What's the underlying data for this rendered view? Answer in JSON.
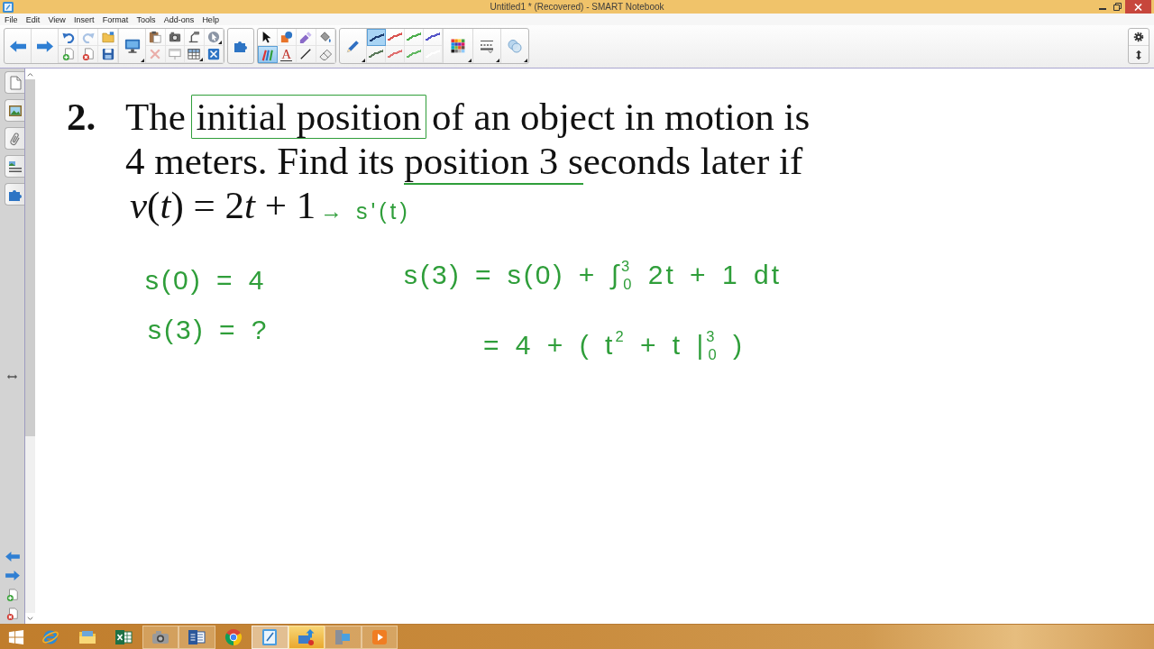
{
  "window": {
    "title": "Untitled1 * (Recovered) - SMART Notebook"
  },
  "menu": [
    "File",
    "Edit",
    "View",
    "Insert",
    "Format",
    "Tools",
    "Add-ons",
    "Help"
  ],
  "toolbar": {
    "edit_buttons": [
      {
        "kind": "undo",
        "disabled": false
      },
      {
        "kind": "redo",
        "disabled": true
      },
      {
        "kind": "open",
        "disabled": false
      },
      {
        "kind": "add_page",
        "disabled": false
      },
      {
        "kind": "delete_page",
        "disabled": false
      },
      {
        "kind": "save",
        "disabled": false
      }
    ],
    "object_buttons": [
      {
        "kind": "paste",
        "disabled": false
      },
      {
        "kind": "capture",
        "disabled": false
      },
      {
        "kind": "document_camera",
        "disabled": false
      },
      {
        "kind": "response",
        "disabled": false
      },
      {
        "kind": "delete",
        "disabled": true
      },
      {
        "kind": "screen_shade",
        "disabled": false
      },
      {
        "kind": "table",
        "disabled": false
      },
      {
        "kind": "full_screen",
        "disabled": false
      }
    ],
    "tools": [
      {
        "kind": "select",
        "selected": false
      },
      {
        "kind": "shapes",
        "selected": false
      },
      {
        "kind": "magic_pen",
        "selected": false
      },
      {
        "kind": "fill",
        "selected": false
      },
      {
        "kind": "pens",
        "selected": true
      },
      {
        "kind": "text",
        "selected": false,
        "glyph": "A"
      },
      {
        "kind": "line",
        "selected": false
      },
      {
        "kind": "eraser",
        "selected": false
      }
    ],
    "pen_styles": [
      {
        "color": "#1c3a6e",
        "selected": true
      },
      {
        "color": "#d9534f",
        "selected": false
      },
      {
        "color": "#4cae4c",
        "selected": false
      },
      {
        "color": "#5454c8",
        "selected": false
      },
      {
        "color": "#5b7a5b",
        "selected": false
      },
      {
        "color": "#e07070",
        "selected": false
      },
      {
        "color": "#62b862",
        "selected": false
      },
      {
        "color": "#ffffff",
        "selected": false
      }
    ]
  },
  "page": {
    "problem": {
      "number": "2.",
      "text": [
        {
          "text": "The ",
          "boxed": false,
          "underlined": false
        },
        {
          "text": "initial position",
          "boxed": true,
          "underlined": false
        },
        {
          "text": " of an object in motion is 4 meters. Find its ",
          "boxed": false,
          "underlined": false
        },
        {
          "text": "position 3 s",
          "boxed": false,
          "underlined": true
        },
        {
          "text": "econds later if",
          "boxed": false,
          "underlined": false
        }
      ],
      "equation": [
        {
          "text": "v",
          "italic": true
        },
        {
          "text": "(",
          "italic": false
        },
        {
          "text": "t",
          "italic": true
        },
        {
          "text": ") = 2",
          "italic": false
        },
        {
          "text": "t",
          "italic": true
        },
        {
          "text": " + 1",
          "italic": false
        }
      ]
    },
    "ink": [
      "→ s'(t)",
      "s(0) = 4",
      "s(3) = ?",
      "s(3) = s(0) + ∫$^{3}$$_{0}$ 2t + 1 dt",
      "= 4 + ( t$^{2}$ + t |$^{3}$$_{0}$ )"
    ]
  },
  "taskbar": [
    {
      "kind": "start",
      "running": false,
      "active": false,
      "highlighted": false
    },
    {
      "kind": "web_browser",
      "running": false,
      "active": false,
      "highlighted": false
    },
    {
      "kind": "file_manager",
      "running": false,
      "active": false,
      "highlighted": false
    },
    {
      "kind": "spreadsheet",
      "running": false,
      "active": false,
      "highlighted": false
    },
    {
      "kind": "camera",
      "running": true,
      "active": false,
      "highlighted": false
    },
    {
      "kind": "word_processor",
      "running": true,
      "active": false,
      "highlighted": false
    },
    {
      "kind": "browser",
      "running": false,
      "active": false,
      "highlighted": false
    },
    {
      "kind": "notebook",
      "running": true,
      "active": true,
      "highlighted": false
    },
    {
      "kind": "transfer",
      "running": true,
      "active": false,
      "highlighted": true
    },
    {
      "kind": "recorder",
      "running": true,
      "active": false,
      "highlighted": false
    },
    {
      "kind": "player",
      "running": true,
      "active": false,
      "highlighted": false
    }
  ]
}
